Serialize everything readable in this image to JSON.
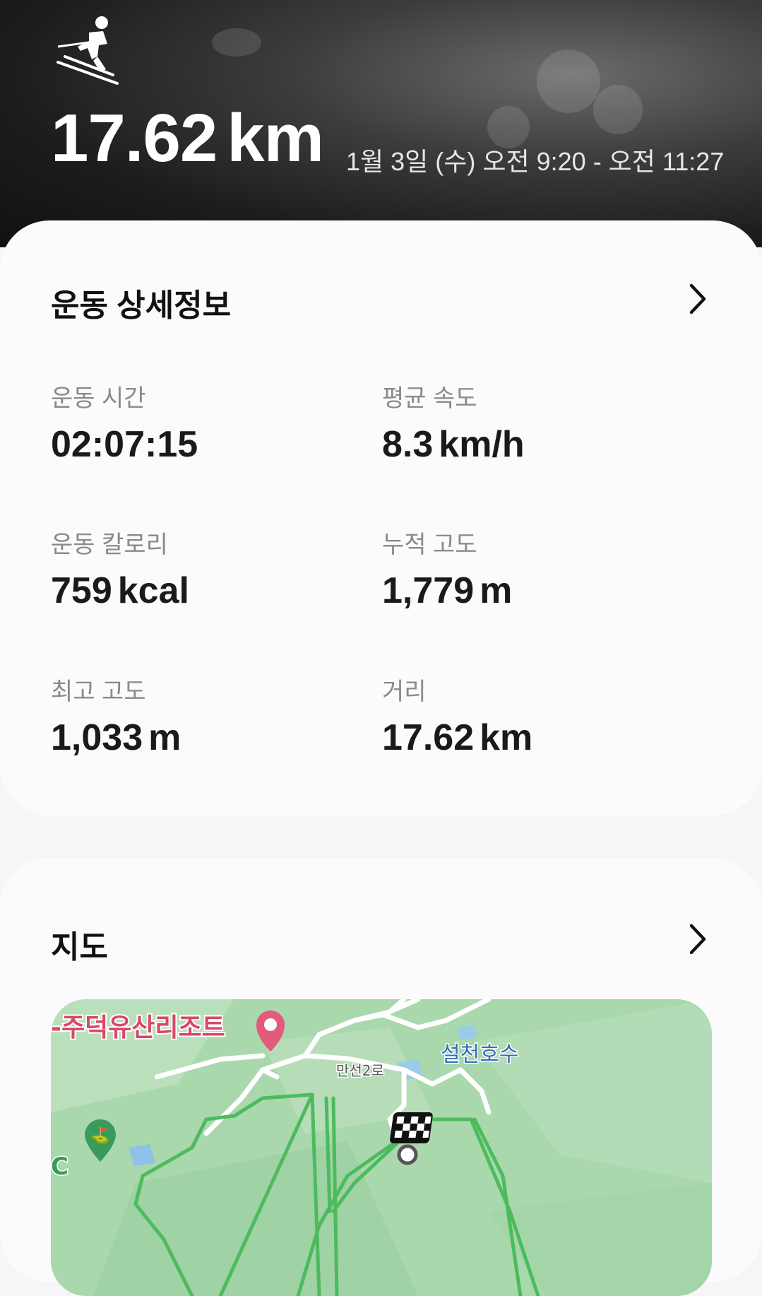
{
  "header": {
    "activity_icon": "skiing-icon",
    "distance_value": "17.62",
    "distance_unit": "km",
    "datetime": "1월 3일 (수) 오전 9:20 - 오전 11:27"
  },
  "details": {
    "title": "운동 상세정보",
    "stats": [
      {
        "label": "운동 시간",
        "value": "02:07:15",
        "unit": ""
      },
      {
        "label": "평균 속도",
        "value": "8.3",
        "unit": "km/h"
      },
      {
        "label": "운동 칼로리",
        "value": "759",
        "unit": "kcal"
      },
      {
        "label": "누적 고도",
        "value": "1,779",
        "unit": "m"
      },
      {
        "label": "최고 고도",
        "value": "1,033",
        "unit": "m"
      },
      {
        "label": "거리",
        "value": "17.62",
        "unit": "km"
      }
    ]
  },
  "map": {
    "title": "지도",
    "labels": {
      "resort": "-주덕유산리조트",
      "lake": "설천호수",
      "road": "만선2로",
      "left_edge": "C"
    },
    "colors": {
      "route": "#4cbb5e",
      "resort_pin": "#e45a7c",
      "lake_label": "#2f6fb5"
    }
  }
}
